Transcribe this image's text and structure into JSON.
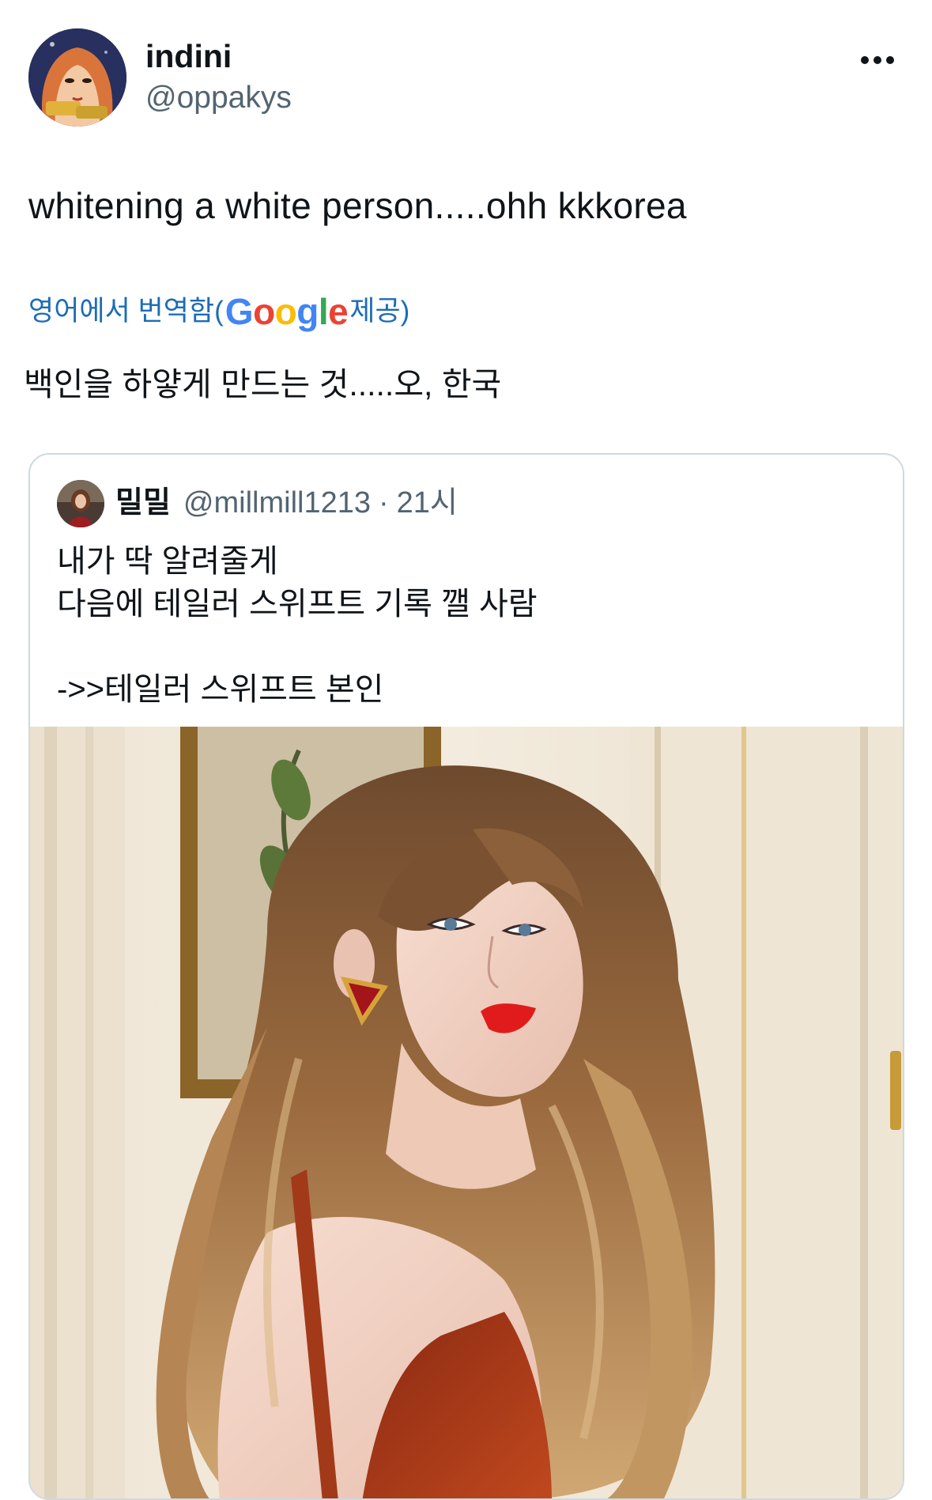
{
  "tweet": {
    "display_name": "indini",
    "handle": "@oppakys",
    "text": "whitening a white person.....ohh kkkorea",
    "more_icon": "more-horizontal-icon",
    "translation": {
      "prefix": "영어에서 번역함(",
      "provider": "Google",
      "suffix": " 제공)",
      "text": "백인을 하얗게 만드는 것.....오, 한국"
    }
  },
  "quoted": {
    "display_name": "밀밀",
    "handle": "@millmill1213",
    "separator": "·",
    "time": "21시",
    "lines": [
      "내가 딱 알려줄게",
      "다음에 테일러 스위프트 기록 깰 사람",
      "",
      "->>테일러 스위프트 본인"
    ]
  },
  "colors": {
    "text": "#0f1419",
    "secondary": "#536471",
    "link": "#1d6cb5",
    "border": "#cfd9de"
  }
}
